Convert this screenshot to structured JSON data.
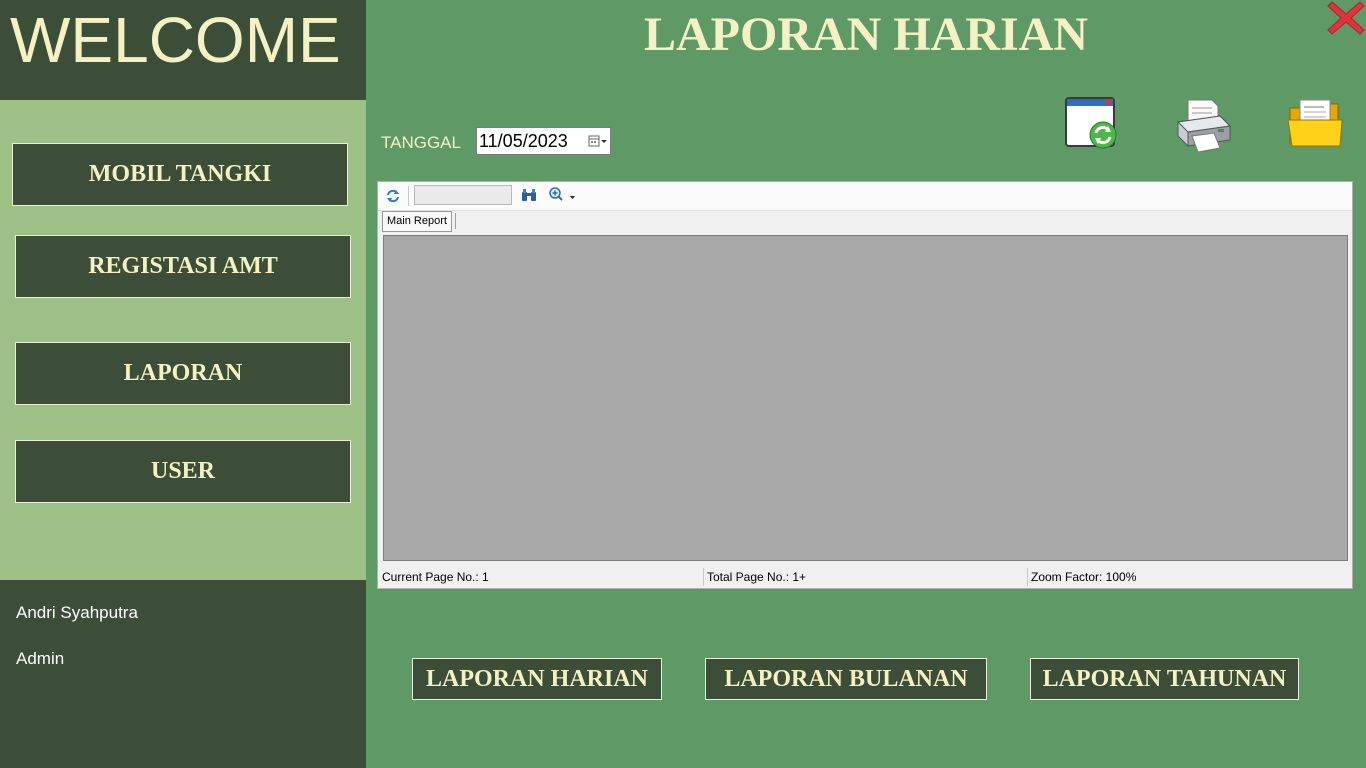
{
  "sidebar": {
    "welcome": "WELCOME",
    "nav": [
      {
        "label": "MOBIL TANGKI"
      },
      {
        "label": "REGISTASI AMT"
      },
      {
        "label": "LAPORAN"
      },
      {
        "label": "USER"
      }
    ],
    "user_name": "Andri Syahputra",
    "user_role": "Admin"
  },
  "header": {
    "title": "LAPORAN HARIAN"
  },
  "filter": {
    "date_label": "TANGGAL",
    "date_value": "11/05/2023"
  },
  "toolbar_icons": [
    "refresh-window-icon",
    "printer-icon",
    "folder-icon"
  ],
  "report_viewer": {
    "tab_label": "Main Report",
    "status": {
      "current_page": "Current Page No.: 1",
      "total_page": "Total Page No.: 1+",
      "zoom": "Zoom Factor: 100%"
    }
  },
  "report_buttons": [
    {
      "label": "LAPORAN HARIAN"
    },
    {
      "label": "LAPORAN BULANAN"
    },
    {
      "label": "LAPORAN TAHUNAN"
    }
  ],
  "colors": {
    "background": "#5f9966",
    "sidebar_dark": "#3c4e38",
    "sidebar_light": "#9dc087",
    "accent_text": "#f4f2c4",
    "close_red": "#e0343a"
  }
}
